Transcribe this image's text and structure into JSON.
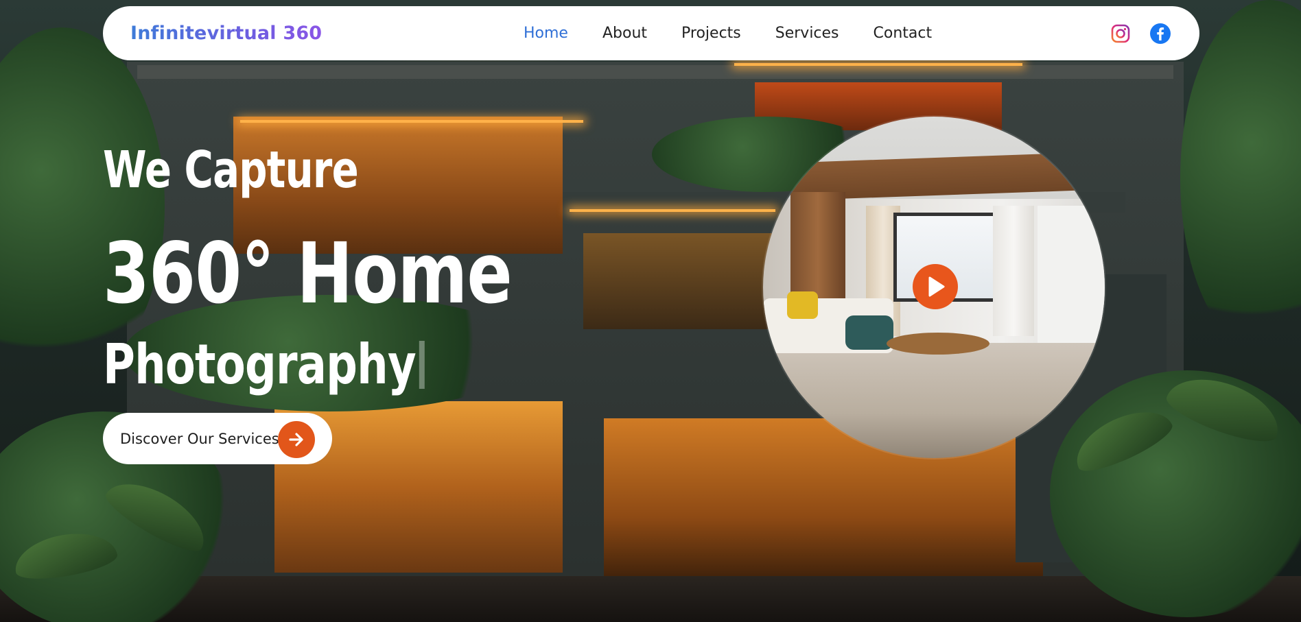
{
  "brand": {
    "name": "Infinitevirtual 360"
  },
  "nav": {
    "items": [
      {
        "label": "Home",
        "active": true
      },
      {
        "label": "About",
        "active": false
      },
      {
        "label": "Projects",
        "active": false
      },
      {
        "label": "Services",
        "active": false
      },
      {
        "label": "Contact",
        "active": false
      }
    ]
  },
  "socials": [
    {
      "icon": "instagram-icon",
      "color": "#e1306c"
    },
    {
      "icon": "facebook-icon",
      "color": "#1877f2"
    }
  ],
  "hero": {
    "line1": "We Capture",
    "line2": "360° Home",
    "line3": "Photography",
    "cta_label": "Discover Our Services",
    "cta_icon": "arrow-right-icon"
  },
  "preview": {
    "icon": "play-icon"
  },
  "colors": {
    "accent": "#e2561a",
    "nav_active": "#2f6fd6",
    "brand_gradient_start": "#3d7bd8",
    "brand_gradient_end": "#8a55e6"
  }
}
